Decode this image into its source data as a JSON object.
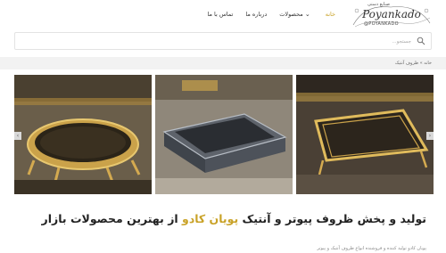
{
  "header": {
    "logo_top": "صنایع دستی",
    "logo_text": "Poyankado",
    "logo_sub": "@POYANKADO",
    "nav": [
      {
        "label": "خانه",
        "active": true
      },
      {
        "label": "محصولات",
        "dropdown": true
      },
      {
        "label": "درباره ما"
      },
      {
        "label": "تماس با ما"
      }
    ]
  },
  "search": {
    "placeholder": "جستجو..."
  },
  "breadcrumb": "خانه » ظروف آنتیک",
  "page_title": "ظروف آنتیک",
  "gallery": {
    "slides": [
      "gold-round-tray",
      "silver-rect-tray",
      "gold-rect-tray"
    ],
    "prev_icon": "chevron-left-icon",
    "next_icon": "chevron-right-icon"
  },
  "headline": {
    "part1": "تولید و پخش ظروف پیوتر و آنتیک",
    "brand": "پویان کادو",
    "part2": "از بهترین محصولات بازار"
  },
  "description": "پویان کادو تولید کننده و فروشنده انواع ظروف آنتیک و پیوتر",
  "colors": {
    "accent": "#c9a227",
    "gold": "#c8a03a",
    "silver": "#9aa0a8"
  }
}
